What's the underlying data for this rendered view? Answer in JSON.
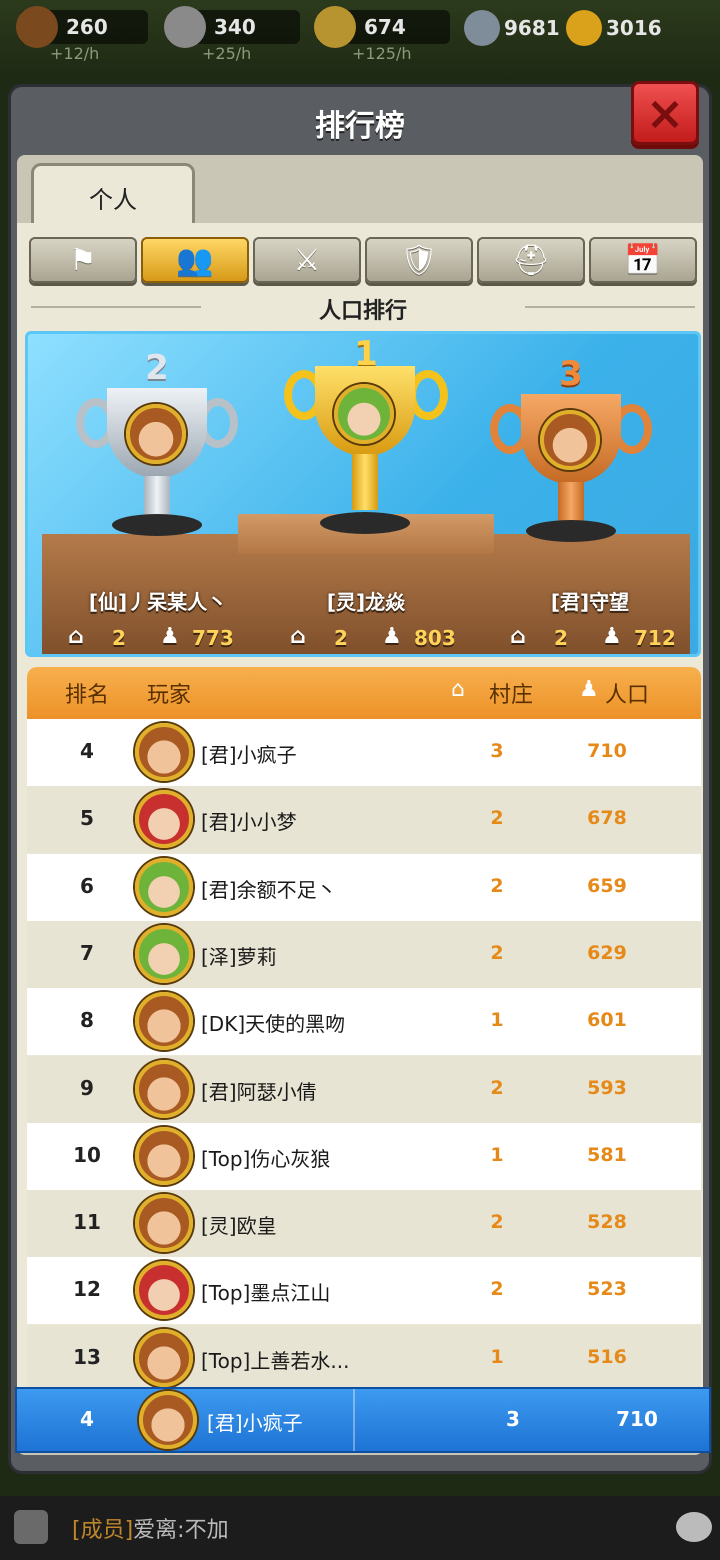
{
  "resources": [
    {
      "name": "wood",
      "value": "260",
      "rate": "+12/h",
      "color": "#7a4a1e"
    },
    {
      "name": "stone",
      "value": "340",
      "rate": "+25/h",
      "color": "#8a8a8a"
    },
    {
      "name": "wheat",
      "value": "674",
      "rate": "+125/h",
      "color": "#b7942f"
    }
  ],
  "currency": [
    {
      "name": "silver",
      "value": "9681",
      "color": "#7f8c99"
    },
    {
      "name": "gold",
      "value": "3016",
      "color": "#d9a21a"
    }
  ],
  "panel": {
    "title": "排行榜",
    "close_label": "×",
    "tab_personal": "个人",
    "section_title": "人口排行"
  },
  "categories": [
    {
      "icon": "territory-icon",
      "glyph": "⚑",
      "active": false
    },
    {
      "icon": "population-icon",
      "glyph": "👥",
      "active": true
    },
    {
      "icon": "attack-icon",
      "glyph": "⚔",
      "active": false
    },
    {
      "icon": "defense-icon",
      "glyph": "🛡",
      "active": false
    },
    {
      "icon": "hero-icon",
      "glyph": "⛑",
      "active": false
    },
    {
      "icon": "calendar-icon",
      "glyph": "📅",
      "active": false
    }
  ],
  "podium": [
    {
      "place": "2",
      "name": "[仙]丿呆某人丶",
      "villages": "2",
      "population": "773"
    },
    {
      "place": "1",
      "name": "[灵]龙焱",
      "villages": "2",
      "population": "803"
    },
    {
      "place": "3",
      "name": "[君]守望",
      "villages": "2",
      "population": "712"
    }
  ],
  "table_header": {
    "rank": "排名",
    "player": "玩家",
    "villages": "村庄",
    "population": "人口"
  },
  "rows": [
    {
      "rank": "4",
      "name": "[君]小疯子",
      "villages": "3",
      "population": "710",
      "avatar": "brown"
    },
    {
      "rank": "5",
      "name": "[君]小小梦",
      "villages": "2",
      "population": "678",
      "avatar": "red"
    },
    {
      "rank": "6",
      "name": "[君]余额不足丶",
      "villages": "2",
      "population": "659",
      "avatar": "green"
    },
    {
      "rank": "7",
      "name": "[泽]萝莉",
      "villages": "2",
      "population": "629",
      "avatar": "green"
    },
    {
      "rank": "8",
      "name": "[DK]天使的黑吻",
      "villages": "1",
      "population": "601",
      "avatar": "brown"
    },
    {
      "rank": "9",
      "name": "[君]阿瑟小倩",
      "villages": "2",
      "population": "593",
      "avatar": "brown"
    },
    {
      "rank": "10",
      "name": "[Top]伤心灰狼",
      "villages": "1",
      "population": "581",
      "avatar": "brown"
    },
    {
      "rank": "11",
      "name": "[灵]欧皇",
      "villages": "2",
      "population": "528",
      "avatar": "brown"
    },
    {
      "rank": "12",
      "name": "[Top]墨点江山",
      "villages": "2",
      "population": "523",
      "avatar": "red"
    },
    {
      "rank": "13",
      "name": "[Top]上善若水...",
      "villages": "1",
      "population": "516",
      "avatar": "brown"
    }
  ],
  "self_row": {
    "rank": "4",
    "name": "[君]小疯子",
    "villages": "3",
    "population": "710"
  },
  "chat": {
    "tag": "[成员]",
    "text": "爱离:不加"
  }
}
